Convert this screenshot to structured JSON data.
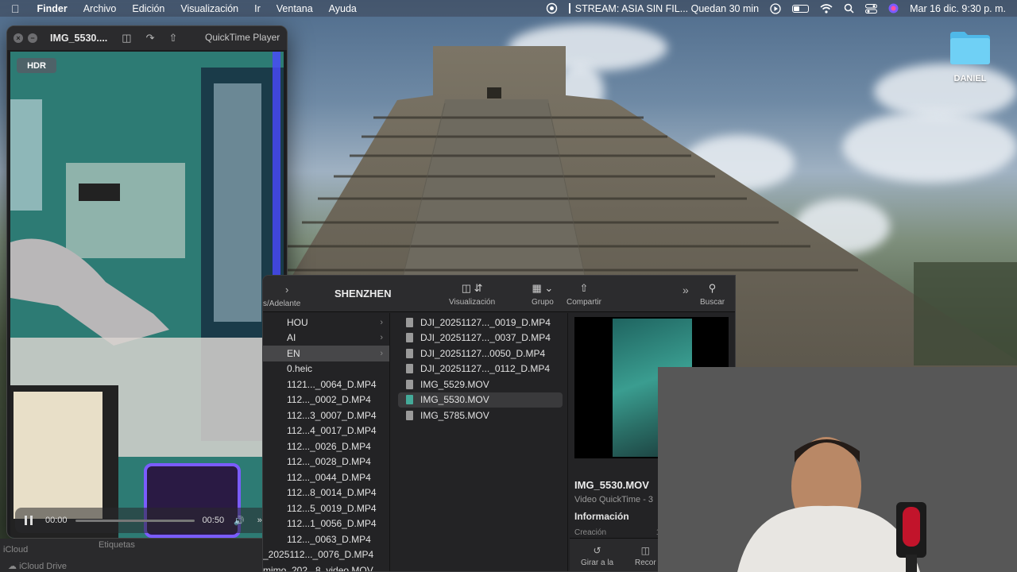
{
  "menubar": {
    "apple_icon": "apple-icon",
    "app_name": "Finder",
    "menus": [
      "Archivo",
      "Edición",
      "Visualización",
      "Ir",
      "Ventana",
      "Ayuda"
    ],
    "stream_text": "STREAM: ASIA SIN FIL... Quedan 30 min",
    "datetime": "Mar 16 dic.  9:30 p. m."
  },
  "desktop": {
    "folder_label": "DANIEL",
    "folder_color": "#5ac8fa"
  },
  "quicktime": {
    "title": "IMG_5530....",
    "app_label": "QuickTime Player",
    "hdr_badge": "HDR",
    "time_elapsed": "00:00",
    "time_remaining": "00:50"
  },
  "finder": {
    "toolbar": {
      "nav_label": "s/Adelante",
      "folder_title": "SHENZHEN",
      "view_label": "Visualización",
      "group_label": "Grupo",
      "share_label": "Compartir",
      "search_label": "Buscar"
    },
    "column1": [
      {
        "label": "HOU",
        "chevron": true
      },
      {
        "label": "AI",
        "chevron": true
      },
      {
        "label": "EN",
        "chevron": true,
        "selected": true
      },
      {
        "label": "0.heic"
      },
      {
        "label": "1121..._0064_D.MP4"
      },
      {
        "label": "112..._0002_D.MP4"
      },
      {
        "label": "112...3_0007_D.MP4"
      },
      {
        "label": "112...4_0017_D.MP4"
      },
      {
        "label": "112..._0026_D.MP4"
      },
      {
        "label": "112..._0028_D.MP4"
      },
      {
        "label": "112..._0044_D.MP4"
      },
      {
        "label": "112...8_0014_D.MP4"
      },
      {
        "label": "112...5_0019_D.MP4"
      },
      {
        "label": "112...1_0056_D.MP4"
      },
      {
        "label": "112..._0063_D.MP4"
      },
      {
        "label": "_2025112..._0076_D.MP4"
      },
      {
        "label": "mimo_202...8_video.MOV"
      }
    ],
    "column2": [
      {
        "label": "DJI_20251127..._0019_D.MP4"
      },
      {
        "label": "DJI_20251127..._0037_D.MP4"
      },
      {
        "label": "DJI_20251127...0050_D.MP4"
      },
      {
        "label": "DJI_20251127..._0112_D.MP4"
      },
      {
        "label": "IMG_5529.MOV"
      },
      {
        "label": "IMG_5530.MOV",
        "selected": true
      },
      {
        "label": "IMG_5785.MOV"
      }
    ],
    "preview": {
      "name": "IMG_5530.MOV",
      "kind": "Video QuickTime - 3",
      "info_heading": "Información",
      "created_label": "Creación",
      "created_value": "11",
      "action_share": "Girar a la",
      "action_trim": "Recor"
    }
  },
  "sidebar": {
    "icloud": "iCloud",
    "icloud_drive": "iCloud Drive",
    "tags": "Etiquetas"
  }
}
